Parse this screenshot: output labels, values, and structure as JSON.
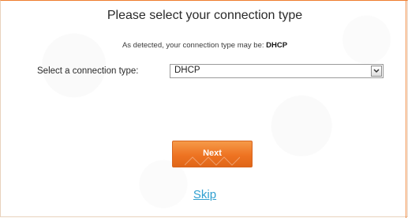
{
  "heading": {
    "title": "Please select your connection type",
    "detected_prefix": "As detected, your connection type may be:",
    "detected_value": "DHCP"
  },
  "connection_select": {
    "label": "Select a connection type:",
    "value": "DHCP",
    "icon": "chevron-down-icon"
  },
  "actions": {
    "next_label": "Next",
    "skip_label": "Skip"
  },
  "colors": {
    "accent": "#ee7322",
    "link": "#2f9fd0"
  }
}
